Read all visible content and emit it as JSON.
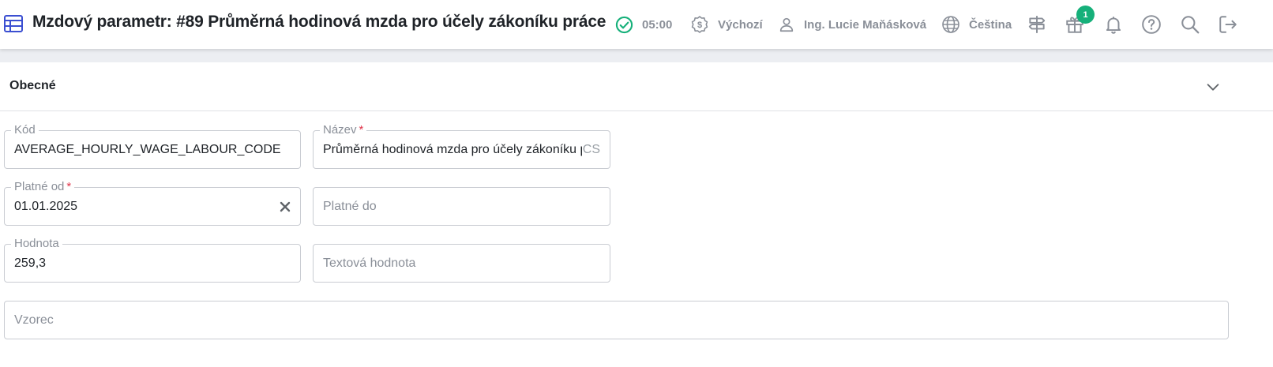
{
  "header": {
    "title": "Mzdový parametr: #89 Průměrná hodinová mzda pro účely zákoníku práce",
    "time": "05:00",
    "currency": "Výchozí",
    "user": "Ing. Lucie Maňásková",
    "language": "Čeština",
    "gift_badge_count": "1",
    "accent_color": "#3b4fd1",
    "status_color": "#16b07a"
  },
  "section": {
    "title": "Obecné"
  },
  "fields": {
    "code": {
      "label": "Kód",
      "value": "AVERAGE_HOURLY_WAGE_LABOUR_CODE"
    },
    "name": {
      "label": "Název",
      "required": "*",
      "value": "Průměrná hodinová mzda pro účely zákoníku práce",
      "suffix": "CS"
    },
    "valid_from": {
      "label": "Platné od",
      "required": "*",
      "value": "01.01.2025"
    },
    "valid_to": {
      "placeholder": "Platné do"
    },
    "value": {
      "label": "Hodnota",
      "value": "259,3"
    },
    "text_value": {
      "placeholder": "Textová hodnota"
    },
    "formula": {
      "placeholder": "Vzorec"
    }
  }
}
